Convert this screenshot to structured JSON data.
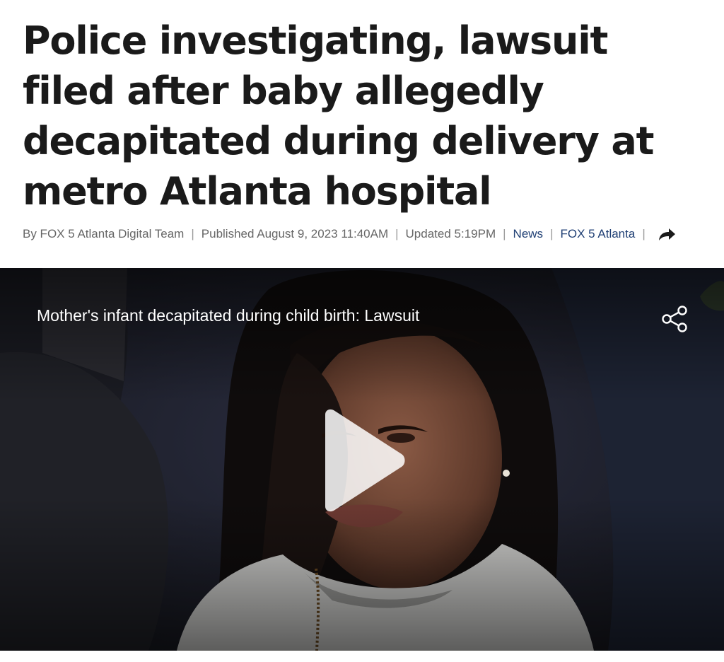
{
  "article": {
    "headline": "Police investigating, lawsuit filed after baby allegedly decapitated during delivery at metro Atlanta hospital",
    "byline": {
      "author": "By FOX 5 Atlanta Digital Team",
      "published": "Published August 9, 2023 11:40AM",
      "updated": "Updated 5:19PM",
      "category_link": "News",
      "source_link": "FOX 5 Atlanta",
      "separator": "|",
      "share_icon": "share-arrow-icon"
    }
  },
  "video": {
    "title": "Mother's infant decapitated during child birth: Lawsuit",
    "share_icon": "share-nodes-icon",
    "play_icon": "play-icon"
  }
}
